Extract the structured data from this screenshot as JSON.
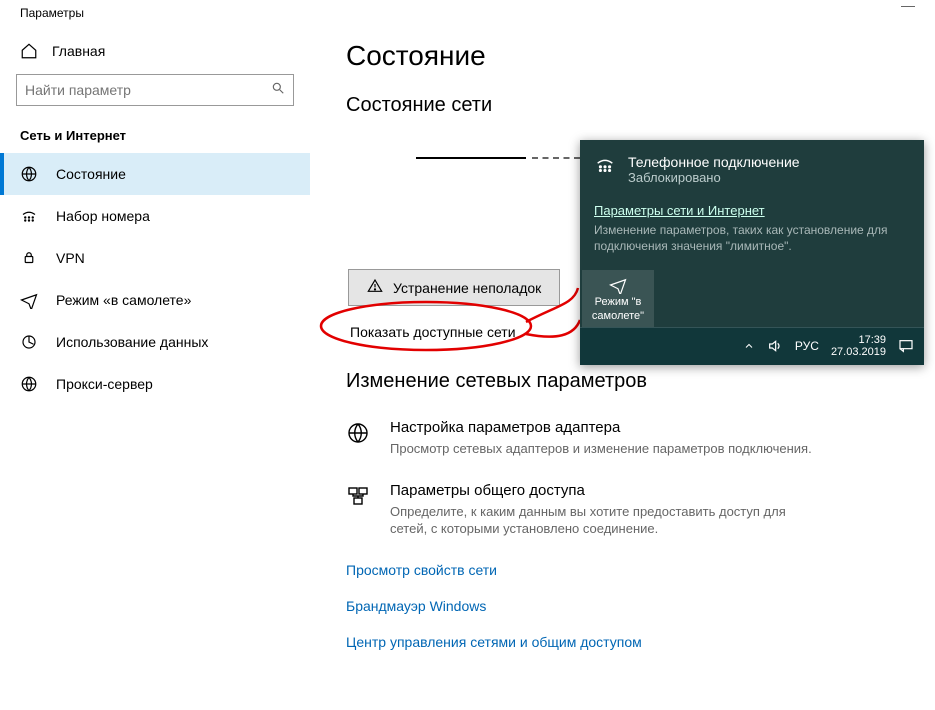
{
  "window": {
    "title": "Параметры"
  },
  "sidebar": {
    "home_label": "Главная",
    "search_placeholder": "Найти параметр",
    "section": "Сеть и Интернет",
    "items": [
      {
        "label": "Состояние",
        "active": true
      },
      {
        "label": "Набор номера"
      },
      {
        "label": "VPN"
      },
      {
        "label": "Режим «в самолете»"
      },
      {
        "label": "Использование данных"
      },
      {
        "label": "Прокси-сервер"
      }
    ]
  },
  "main": {
    "title": "Состояние",
    "subtitle": "Состояние сети",
    "troubleshoot_label": "Устранение неполадок",
    "show_networks_label": "Показать доступные сети",
    "change_heading": "Изменение сетевых параметров",
    "adapter": {
      "title": "Настройка параметров адаптера",
      "desc": "Просмотр сетевых адаптеров и изменение параметров подключения."
    },
    "sharing": {
      "title": "Параметры общего доступа",
      "desc": "Определите, к каким данным вы хотите предоставить доступ для сетей, с которыми установлено соединение."
    },
    "links": {
      "view_props": "Просмотр свойств сети",
      "firewall": "Брандмауэр Windows",
      "sharing_center": "Центр управления сетями и общим доступом"
    }
  },
  "flyout": {
    "conn_title": "Телефонное подключение",
    "conn_status": "Заблокировано",
    "settings_link": "Параметры сети и Интернет",
    "settings_desc": "Изменение параметров, таких как установление для подключения значения \"лимитное\".",
    "tile_label": "Режим \"в самолете\""
  },
  "taskbar": {
    "lang": "РУС",
    "time": "17:39",
    "date": "27.03.2019"
  }
}
